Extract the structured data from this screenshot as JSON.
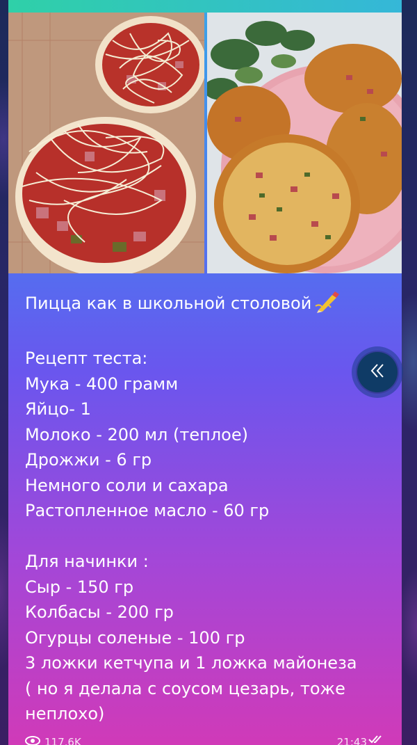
{
  "message": {
    "title": "Пицца как в школьной столовой",
    "dough_heading": "Рецепт теста:",
    "dough": [
      "Мука - 400 грамм",
      "Яйцо- 1",
      "Молоко - 200 мл (теплое)",
      "Дрожжи - 6 гр",
      "Немного соли и сахара",
      "Растопленное масло - 60 гр"
    ],
    "filling_heading": "Для начинки :",
    "filling": [
      "Сыр - 150 гр",
      "Колбасы - 200 гр",
      "Огурцы соленые - 100 гр",
      "3 ложки кетчупа и 1 ложка майонеза"
    ],
    "note": "( но я делала с соусом цезарь, тоже неплохо)"
  },
  "footer": {
    "views": "117,6K",
    "time": "21:43"
  },
  "icons": {
    "emoji": "pen-icon",
    "scroll": "double-chevron-left-icon",
    "views": "eye-icon",
    "read": "double-check-icon"
  },
  "colors": {
    "bubble_top": "#3aa6e8",
    "bubble_bottom": "#d03ab8",
    "scroll_button": "#0f3b66"
  }
}
